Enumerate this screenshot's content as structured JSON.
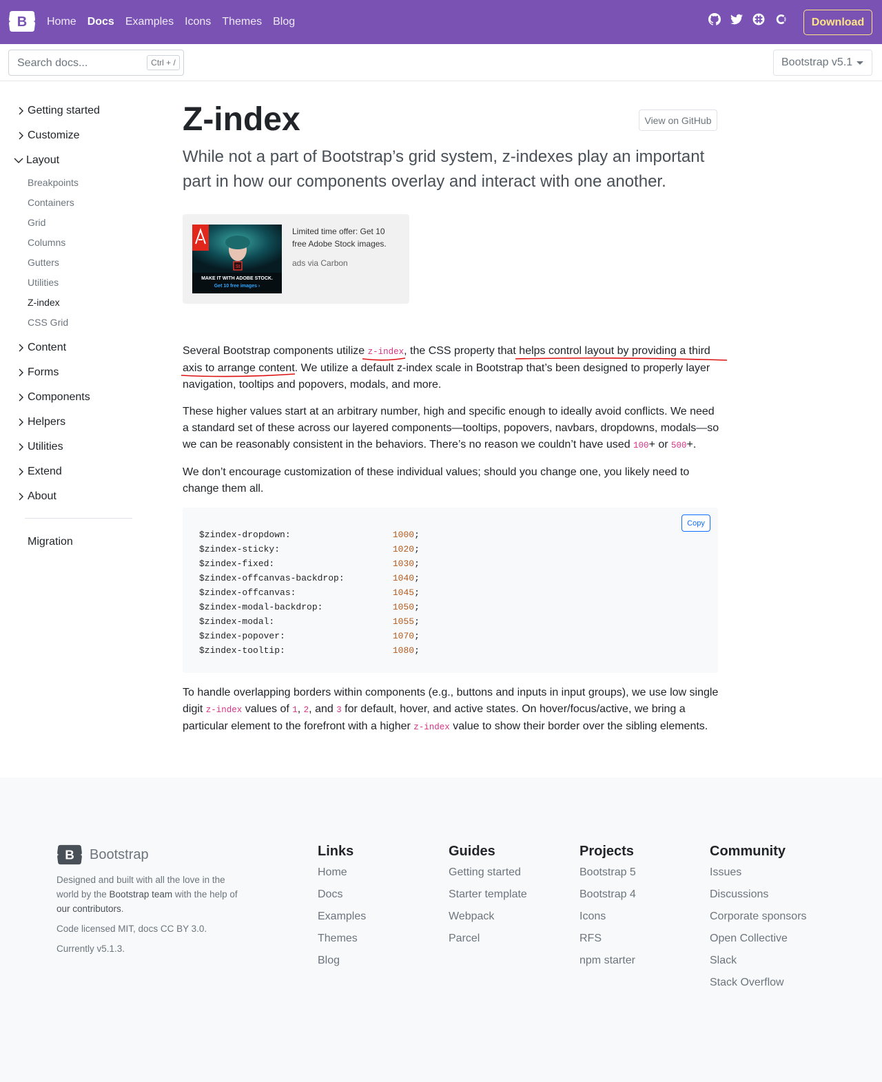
{
  "navbar": {
    "brand_letter": "B",
    "links": [
      {
        "label": "Home",
        "active": false
      },
      {
        "label": "Docs",
        "active": true
      },
      {
        "label": "Examples",
        "active": false
      },
      {
        "label": "Icons",
        "active": false
      },
      {
        "label": "Themes",
        "active": false
      },
      {
        "label": "Blog",
        "active": false
      }
    ],
    "icons": [
      "github-icon",
      "twitter-icon",
      "slack-icon",
      "opencollective-icon"
    ],
    "download_label": "Download",
    "bg_color": "#7952b3",
    "accent_color": "#ffe484"
  },
  "subnav": {
    "search_placeholder": "Search docs...",
    "search_shortcut": "Ctrl + /",
    "version_label": "Bootstrap v5.1"
  },
  "sidebar": {
    "groups": [
      {
        "label": "Getting started",
        "expanded": false
      },
      {
        "label": "Customize",
        "expanded": false
      },
      {
        "label": "Layout",
        "expanded": true
      },
      {
        "label": "Content",
        "expanded": false
      },
      {
        "label": "Forms",
        "expanded": false
      },
      {
        "label": "Components",
        "expanded": false
      },
      {
        "label": "Helpers",
        "expanded": false
      },
      {
        "label": "Utilities",
        "expanded": false
      },
      {
        "label": "Extend",
        "expanded": false
      },
      {
        "label": "About",
        "expanded": false
      }
    ],
    "layout_items": [
      {
        "label": "Breakpoints",
        "active": false
      },
      {
        "label": "Containers",
        "active": false
      },
      {
        "label": "Grid",
        "active": false
      },
      {
        "label": "Columns",
        "active": false
      },
      {
        "label": "Gutters",
        "active": false
      },
      {
        "label": "Utilities",
        "active": false
      },
      {
        "label": "Z-index",
        "active": true
      },
      {
        "label": "CSS Grid",
        "active": false
      }
    ],
    "migration_label": "Migration"
  },
  "main": {
    "title": "Z-index",
    "github_button": "View on GitHub",
    "lead": "While not a part of Bootstrap’s grid system, z-indexes play an important part in how our components overlay and interact with one another.",
    "ad": {
      "image_caption_1": "MAKE IT WITH ADOBE STOCK.",
      "image_caption_2": "Get 10 free images ›",
      "text": "Limited time offer: Get 10 free Adobe Stock images.",
      "via": "ads via Carbon"
    },
    "p1": {
      "a": "Several Bootstrap components utilize ",
      "code": "z-index",
      "b": ", the CSS property that helps control layout by providing a third axis to arrange content. We utilize a default z-index scale in Bootstrap that’s been designed to properly layer navigation, tooltips and popovers, modals, and more."
    },
    "p2": {
      "a": "These higher values start at an arbitrary number, high and specific enough to ideally avoid conflicts. We need a standard set of these across our layered components—tooltips, popovers, navbars, dropdowns, modals—so we can be reasonably consistent in the behaviors. There’s no reason we couldn’t have used ",
      "code1": "100",
      "b": "+ or ",
      "code2": "500",
      "c": "+."
    },
    "p3": "We don’t encourage customization of these individual values; should you change one, you likely need to change them all.",
    "copy_label": "Copy",
    "code_lines": [
      {
        "name": "$zindex-dropdown:",
        "value": "1000",
        "end": ";"
      },
      {
        "name": "$zindex-sticky:",
        "value": "1020",
        "end": ";"
      },
      {
        "name": "$zindex-fixed:",
        "value": "1030",
        "end": ";"
      },
      {
        "name": "$zindex-offcanvas-backdrop:",
        "value": "1040",
        "end": ";"
      },
      {
        "name": "$zindex-offcanvas:",
        "value": "1045",
        "end": ";"
      },
      {
        "name": "$zindex-modal-backdrop:",
        "value": "1050",
        "end": ";"
      },
      {
        "name": "$zindex-modal:",
        "value": "1055",
        "end": ";"
      },
      {
        "name": "$zindex-popover:",
        "value": "1070",
        "end": ";"
      },
      {
        "name": "$zindex-tooltip:",
        "value": "1080",
        "end": ";"
      }
    ],
    "p4": {
      "a": "To handle overlapping borders within components (e.g., buttons and inputs in input groups), we use low single digit ",
      "code1": "z-index",
      "b": " values of ",
      "code2": "1",
      "c": ", ",
      "code3": "2",
      "d": ", and ",
      "code4": "3",
      "e": " for default, hover, and active states. On hover/focus/active, we bring a particular element to the forefront with a higher ",
      "code5": "z-index",
      "f": " value to show their border over the sibling elements."
    }
  },
  "footer": {
    "brand_letter": "B",
    "brand_name": "Bootstrap",
    "desc_1": "Designed and built with all the love in the world by the ",
    "desc_team": "Bootstrap team",
    "desc_2": " with the help of ",
    "desc_contrib": "our contributors",
    "desc_3": ".",
    "license": "Code licensed MIT, docs CC BY 3.0.",
    "version": "Currently v5.1.3.",
    "columns": [
      {
        "title": "Links",
        "items": [
          "Home",
          "Docs",
          "Examples",
          "Themes",
          "Blog"
        ]
      },
      {
        "title": "Guides",
        "items": [
          "Getting started",
          "Starter template",
          "Webpack",
          "Parcel"
        ]
      },
      {
        "title": "Projects",
        "items": [
          "Bootstrap 5",
          "Bootstrap 4",
          "Icons",
          "RFS",
          "npm starter"
        ]
      },
      {
        "title": "Community",
        "items": [
          "Issues",
          "Discussions",
          "Corporate sponsors",
          "Open Collective",
          "Slack",
          "Stack Overflow"
        ]
      }
    ]
  }
}
